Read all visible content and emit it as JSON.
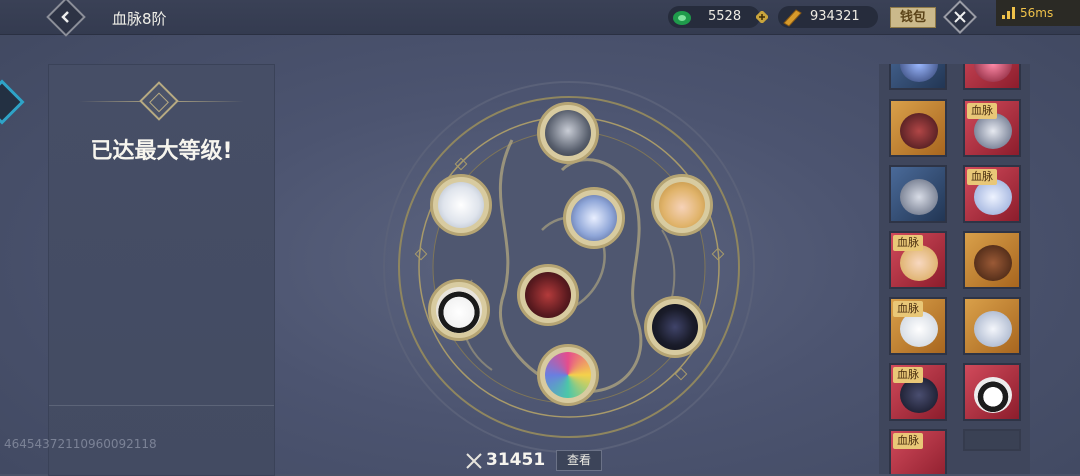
{
  "header": {
    "title": "血脉8阶",
    "currency_1_value": "5528",
    "currency_2_value": "934321",
    "wallet_label": "钱包",
    "ping": "56ms"
  },
  "left_panel": {
    "status_text": "已达最大等级!",
    "uid": "4645437211096009​2118"
  },
  "bottom": {
    "power_value": "31451",
    "view_label": "查看"
  },
  "right_panel": {
    "badge_label": "血脉"
  },
  "colors": {
    "accent_gold": "#cbb98b",
    "ping_yellow": "#f0c24a",
    "badge_bg": "#e9c777"
  }
}
